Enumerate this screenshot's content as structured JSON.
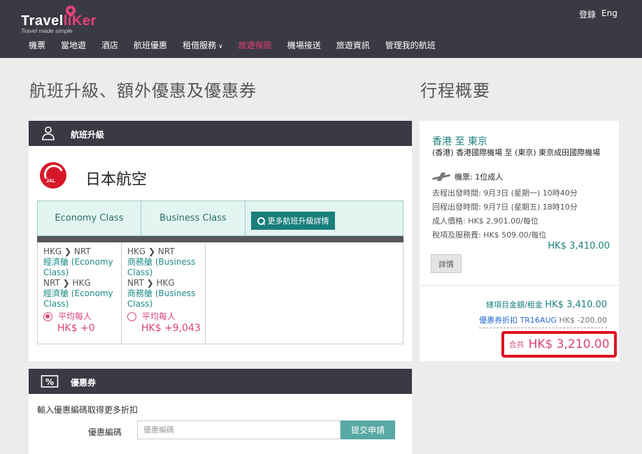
{
  "header": {
    "logo_text_1": "Travel",
    "logo_text_2": "liKer",
    "tagline": "Travel made simple",
    "login": "登錄",
    "language": "Eng"
  },
  "nav": {
    "items": [
      "機票",
      "當地遊",
      "酒店",
      "航班優惠",
      "租借服務",
      "旅遊保險",
      "機場接送",
      "旅遊資訊",
      "管理我的航班"
    ],
    "active": "旅遊保險",
    "dropdown_item": "租借服務"
  },
  "main": {
    "title": "航班升級、額外優惠及優惠券",
    "upgrade_panel": {
      "heading": "航班升級",
      "icon": "user-icon",
      "airline_logo_text": "JAL",
      "airline_name": "日本航空",
      "tabs": [
        "Economy Class",
        "Business Class"
      ],
      "more_button": "更多航班升級詳情",
      "fares": [
        {
          "route1_from": "HKG",
          "route1_to": "NRT",
          "cls1": "經濟艙 (Economy Class)",
          "route2_from": "NRT",
          "route2_to": "HKG",
          "cls2": "經濟艙 (Economy Class)",
          "price_label": "平均每人",
          "price": "HK$ +0",
          "selected": true
        },
        {
          "route1_from": "HKG",
          "route1_to": "NRT",
          "cls1": "商務艙 (Business Class)",
          "route2_from": "NRT",
          "route2_to": "HKG",
          "cls2": "商務艙 (Business Class)",
          "price_label": "平均每人",
          "price": "HK$ +9,043",
          "selected": false
        }
      ]
    },
    "coupon_panel": {
      "heading": "優惠券",
      "icon": "percent-ticket-icon",
      "hint": "輸入優惠編碼取得更多折扣",
      "label": "優惠編碼",
      "placeholder": "優惠編碼",
      "button": "提交申請"
    }
  },
  "summary": {
    "title": "行程概要",
    "route": "香港 至 東京",
    "airports": "(香港) 香港國際機場 至 (東京) 東京成田國際機場",
    "pax": "機票: 1位成人",
    "outbound": "去程出發時間: 9月3日 (星期一) 10時40分",
    "inbound": "回程出發時間: 9月7日 (星期五) 18時10分",
    "adult_price": "成人價格: HK$ 2,901.00/每位",
    "tax": "稅項及服務費: HK$ 509.00/每位",
    "subtotal": "HK$ 3,410.00",
    "detail_button": "詳情",
    "total_label": "總項目金額/租金",
    "total_value": "HK$ 3,410.00",
    "discount_label": "優惠券折扣 TR16AUG",
    "discount_value": "HK$ -200.00",
    "grand_label": "合共",
    "grand_value": "HK$ 3,210.00"
  }
}
